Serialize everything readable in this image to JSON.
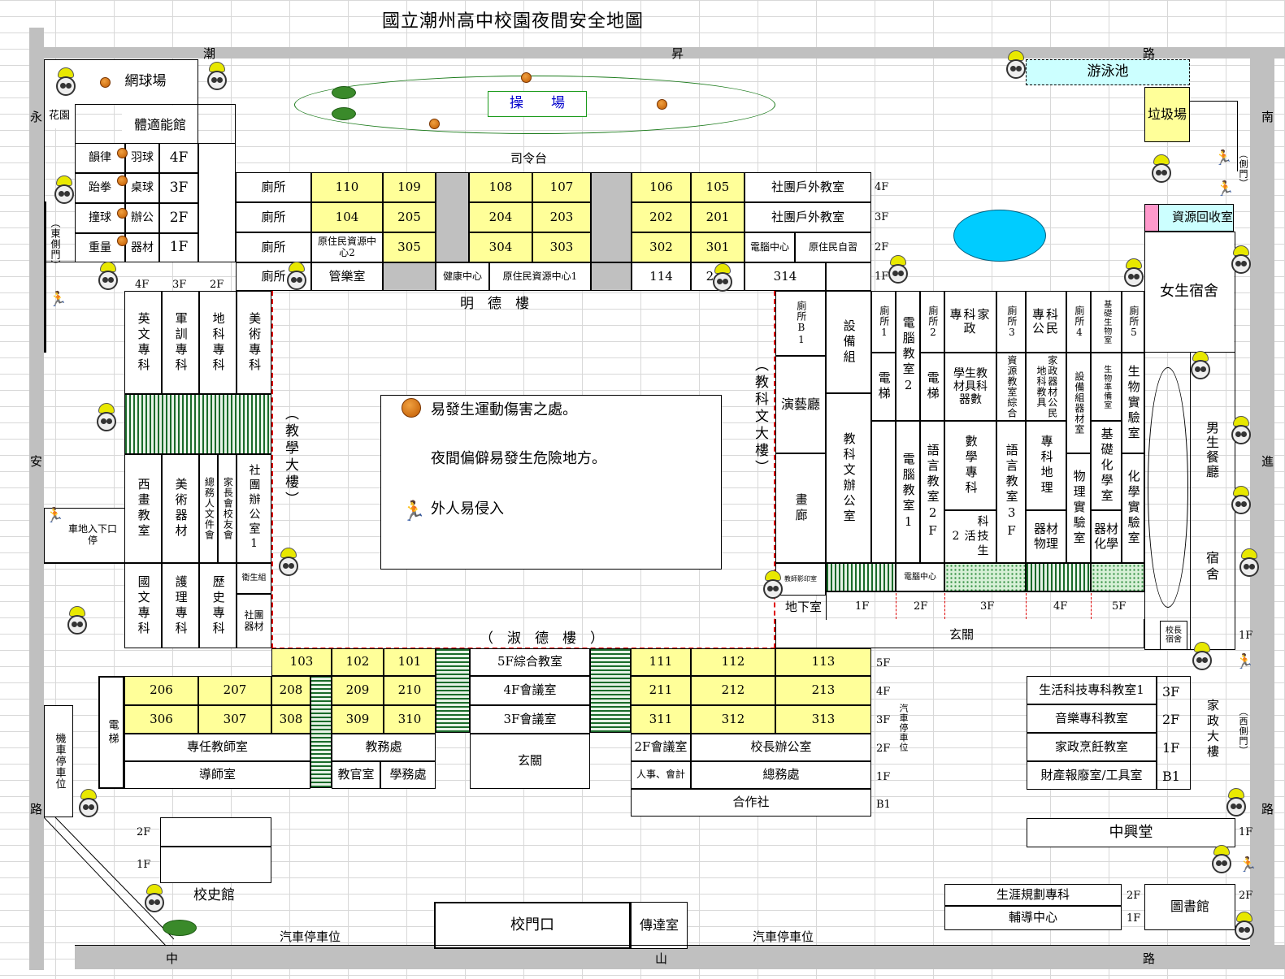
{
  "title": "國立潮州高中校園夜間安全地圖",
  "roads": {
    "north": [
      "潮",
      "昇",
      "路"
    ],
    "south": [
      "中",
      "山",
      "路"
    ],
    "west": [
      "永",
      "安",
      "路"
    ],
    "east": [
      "南",
      "進",
      "路"
    ]
  },
  "field": {
    "label": "操　　場",
    "stage": "司令台"
  },
  "nw": {
    "tennis": "網球場",
    "garden": "花園",
    "fitness": "體適能館",
    "rows": [
      [
        "韻律",
        "羽球",
        "4F"
      ],
      [
        "跆拳",
        "桌球",
        "3F"
      ],
      [
        "撞球",
        "辦公",
        "2F"
      ],
      [
        "重量",
        "器材",
        "1F"
      ]
    ]
  },
  "north_block": {
    "toilet": "廁所",
    "row4": [
      "110",
      "109",
      "108",
      "107",
      "106",
      "105",
      "社團戶外教室",
      "4F"
    ],
    "row3": [
      "104",
      "205",
      "204",
      "203",
      "202",
      "201",
      "社團戶外教室",
      "3F"
    ],
    "row2": [
      "原住民資源中心2",
      "305",
      "304",
      "303",
      "302",
      "301",
      "電腦中心",
      "原住民自習",
      "2F"
    ],
    "row1": [
      "管樂室",
      "健康中心",
      "原住民資源中心1",
      "114",
      "214",
      "314",
      "1F"
    ],
    "name": "明　德　樓"
  },
  "west_block": {
    "floors": [
      "4F",
      "3F",
      "2F"
    ],
    "upper": [
      "英文專科",
      "軍訓專科",
      "地科專科",
      "美術專科"
    ],
    "mid": [
      "西畫教室",
      "美術器材",
      "總務人文件會",
      "家長會校友會",
      "社團辦公室1"
    ],
    "low": [
      "國文專科",
      "護理專科",
      "歷史專科",
      "衛生組",
      "社團器材"
    ],
    "name": "（教學大樓）"
  },
  "east_block": {
    "name": "（教科文大樓）",
    "toilet_b1": "廁所B1",
    "show": "演藝廳",
    "gallery": "畫廊",
    "equip": "設備組",
    "office": "教科文辦公室",
    "cols": [
      [
        "廁所1",
        "電梯"
      ],
      [
        "電腦教室2",
        "電腦教室1"
      ],
      [
        "廁所2",
        "電梯"
      ],
      [
        "專科家政",
        "學生教材具科器數",
        "語言教室2F"
      ],
      [
        "數學專科",
        "2",
        "科技生活"
      ],
      [
        "廁所3",
        "資源教室綜合",
        "語言教室3F"
      ],
      [
        "專科公民",
        "家政器材公民地科教具",
        "專科地理",
        "器材物理"
      ],
      [
        "廁所4",
        "設備組器材室",
        "物理實驗室"
      ],
      [
        "基礎生物室",
        "生物準備室",
        "基礎化學室",
        "器材化學"
      ],
      [
        "廁所5",
        "生物實驗室",
        "化學實驗室"
      ]
    ],
    "basement": "地下室",
    "lobby": "玄關",
    "floors": [
      "1F",
      "2F",
      "3F",
      "4F",
      "5F"
    ],
    "ctr": "電腦中心",
    "printer": "教師影印室"
  },
  "dorm": {
    "girls": "女生宿舍",
    "boys_dining": "男生餐廳",
    "dorm": "宿舍",
    "principal": "校長宿舍",
    "f1": "1F"
  },
  "ne": {
    "pool": "游泳池",
    "garbage": "垃圾場",
    "recycle": "資源回收室",
    "side_gate": "（側門）"
  },
  "legend": {
    "sport": "易發生運動傷害之處。",
    "danger": "夜間偏僻易發生危險地方。",
    "intrude": "外人易侵入"
  },
  "south_block": {
    "name": "（　淑　德　樓　）",
    "r5": [
      "103",
      "102",
      "101",
      "5F綜合教室",
      "111",
      "112",
      "113",
      "5F"
    ],
    "r4": [
      "206",
      "207",
      "208",
      "209",
      "210",
      "4F會議室",
      "211",
      "212",
      "213",
      "4F"
    ],
    "r3": [
      "306",
      "307",
      "308",
      "309",
      "310",
      "3F會議室",
      "311",
      "312",
      "313",
      "3F"
    ],
    "r2": [
      "專任教師室",
      "教務處",
      "玄關",
      "2F會議室",
      "校長辦公室",
      "2F"
    ],
    "r1": [
      "導師室",
      "教官室",
      "學務處",
      "人事、會計",
      "總務處",
      "1F"
    ],
    "b1": [
      "合作社",
      "B1"
    ],
    "elev": "電梯",
    "car": "汽車停車位"
  },
  "sw": {
    "moto": "機車停車位",
    "east_gate": "（東側門）",
    "parking_gate": "車地入下口停",
    "f2": "2F",
    "f1": "1F",
    "history": "校史館"
  },
  "south": {
    "gate": "校門口",
    "guard": "傳達室",
    "car_l": "汽車停車位",
    "car_r": "汽車停車位"
  },
  "se": {
    "rows": [
      [
        "生活科技專科教室1",
        "3F"
      ],
      [
        "音樂專科教室",
        "2F"
      ],
      [
        "家政烹飪教室",
        "1F"
      ],
      [
        "財產報廢室/工具室",
        "B1"
      ]
    ],
    "home_bldg": "家政大樓",
    "west_gate": "（西側門）",
    "hall": "中興堂",
    "hall_f": "1F",
    "career": [
      "生涯規劃專科",
      "輔導中心"
    ],
    "career_f": [
      "2F",
      "1F"
    ],
    "library": "圖書館",
    "lib_f": "2F"
  },
  "colors": {
    "yellow": "#ffff99",
    "gray": "#c0c0c0",
    "cyan": "#ccffff",
    "pink": "#ff99cc",
    "red": "#e00000",
    "pond": "#00ccff"
  }
}
